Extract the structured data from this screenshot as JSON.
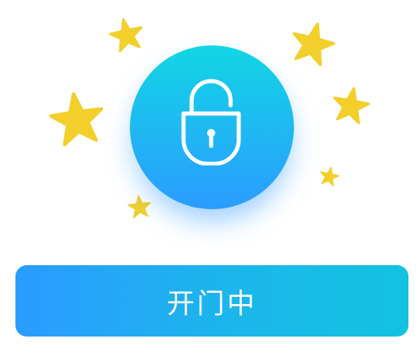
{
  "status_dialog": {
    "button_label": "开门中",
    "icon": "unlocked-padlock-icon",
    "colors": {
      "circle_gradient_top": "#12d6e4",
      "circle_gradient_bottom": "#2b9cff",
      "button_gradient_left": "#2a9cff",
      "button_gradient_right": "#12c2df",
      "star_color": "#f2cf2b"
    }
  }
}
